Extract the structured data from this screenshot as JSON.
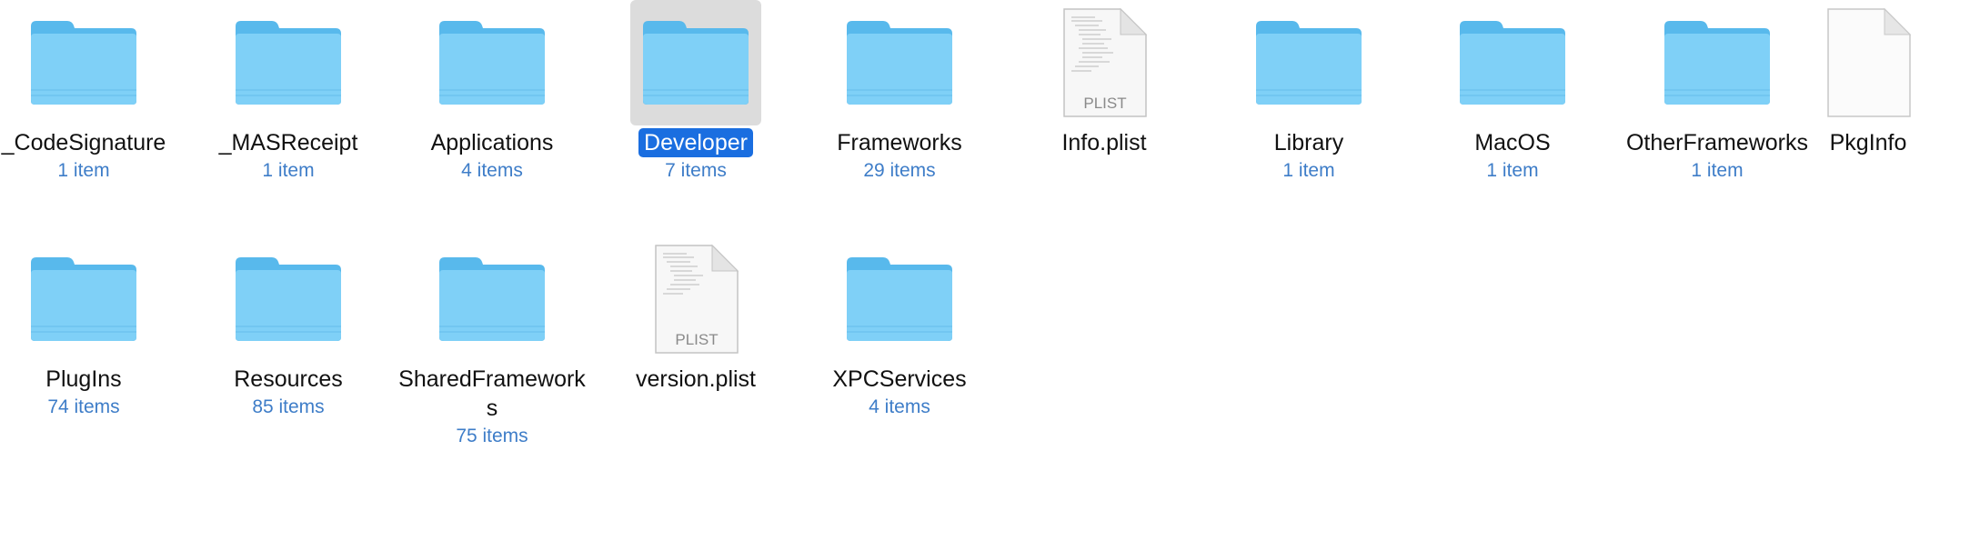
{
  "colors": {
    "folder_front": "#7fd0f7",
    "folder_back": "#58b9ec",
    "item_count": "#3e7dc8",
    "selection_label": "#1a6ee0",
    "selection_tile": "#dcdcdc"
  },
  "items": [
    {
      "name": "_CodeSignature",
      "count": "1 item",
      "kind": "folder"
    },
    {
      "name": "_MASReceipt",
      "count": "1 item",
      "kind": "folder"
    },
    {
      "name": "Applications",
      "count": "4 items",
      "kind": "folder"
    },
    {
      "name": "Developer",
      "count": "7 items",
      "kind": "folder",
      "selected": true
    },
    {
      "name": "Frameworks",
      "count": "29 items",
      "kind": "folder"
    },
    {
      "name": "Info.plist",
      "count": "",
      "kind": "plist",
      "badge": "PLIST"
    },
    {
      "name": "Library",
      "count": "1 item",
      "kind": "folder"
    },
    {
      "name": "MacOS",
      "count": "1 item",
      "kind": "folder"
    },
    {
      "name": "OtherFrameworks",
      "count": "1 item",
      "kind": "folder"
    },
    {
      "name": "PkgInfo",
      "count": "",
      "kind": "blank-doc"
    },
    {
      "name": "PlugIns",
      "count": "74 items",
      "kind": "folder"
    },
    {
      "name": "Resources",
      "count": "85 items",
      "kind": "folder"
    },
    {
      "name": "SharedFrameworks",
      "count": "75 items",
      "kind": "folder"
    },
    {
      "name": "version.plist",
      "count": "",
      "kind": "plist",
      "badge": "PLIST"
    },
    {
      "name": "XPCServices",
      "count": "4 items",
      "kind": "folder"
    }
  ]
}
